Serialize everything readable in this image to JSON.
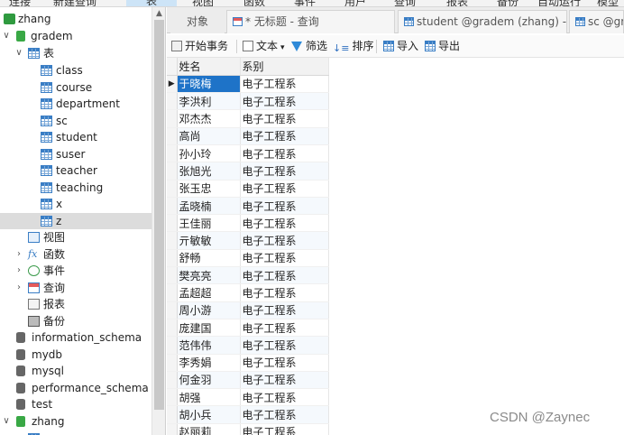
{
  "menubar": {
    "items": [
      "连接",
      "新建查询",
      "表",
      "视图",
      "函数",
      "事件",
      "用户",
      "查询",
      "报表",
      "备份",
      "自动运行",
      "模型"
    ],
    "active": "表"
  },
  "sidebar": {
    "connection": "zhang",
    "database": "gradem",
    "tables_group": "表",
    "tables": [
      "class",
      "course",
      "department",
      "sc",
      "student",
      "suser",
      "teacher",
      "teaching",
      "x",
      "z"
    ],
    "selected_table": "z",
    "groups": [
      "视图",
      "函数",
      "事件",
      "查询",
      "报表",
      "备份"
    ],
    "databases": [
      "information_schema",
      "mydb",
      "mysql",
      "performance_schema",
      "test",
      "zhang"
    ]
  },
  "tabs": [
    {
      "label": "对象",
      "icon": "none"
    },
    {
      "label": "* 无标题 - 查询",
      "icon": "query-icon"
    },
    {
      "label": "student @gradem (zhang) - ...",
      "icon": "table-icon"
    },
    {
      "label": "sc @gra",
      "icon": "table-icon"
    }
  ],
  "toolbar": {
    "begin_transaction": "开始事务",
    "text": "文本",
    "filter": "筛选",
    "sort": "排序",
    "import": "导入",
    "export": "导出"
  },
  "grid": {
    "columns": [
      "姓名",
      "系别"
    ],
    "rows": [
      [
        "于晓梅",
        "电子工程系"
      ],
      [
        "李洪利",
        "电子工程系"
      ],
      [
        "邓杰杰",
        "电子工程系"
      ],
      [
        "高尚",
        "电子工程系"
      ],
      [
        "孙小玲",
        "电子工程系"
      ],
      [
        "张旭光",
        "电子工程系"
      ],
      [
        "张玉忠",
        "电子工程系"
      ],
      [
        "孟晓楠",
        "电子工程系"
      ],
      [
        "王佳丽",
        "电子工程系"
      ],
      [
        "亓敏敏",
        "电子工程系"
      ],
      [
        "舒畅",
        "电子工程系"
      ],
      [
        "樊亮亮",
        "电子工程系"
      ],
      [
        "孟超超",
        "电子工程系"
      ],
      [
        "周小游",
        "电子工程系"
      ],
      [
        "庞建国",
        "电子工程系"
      ],
      [
        "范伟伟",
        "电子工程系"
      ],
      [
        "李秀娟",
        "电子工程系"
      ],
      [
        "何金羽",
        "电子工程系"
      ],
      [
        "胡强",
        "电子工程系"
      ],
      [
        "胡小兵",
        "电子工程系"
      ],
      [
        "赵丽莉",
        "电子工程系"
      ]
    ],
    "selected_row": 0,
    "row_marker": "▶"
  },
  "watermark": "CSDN @Zaynec",
  "colors": {
    "accent": "#1e73c8",
    "db_green": "#39a845",
    "selection_gray": "#dcdcdc"
  }
}
